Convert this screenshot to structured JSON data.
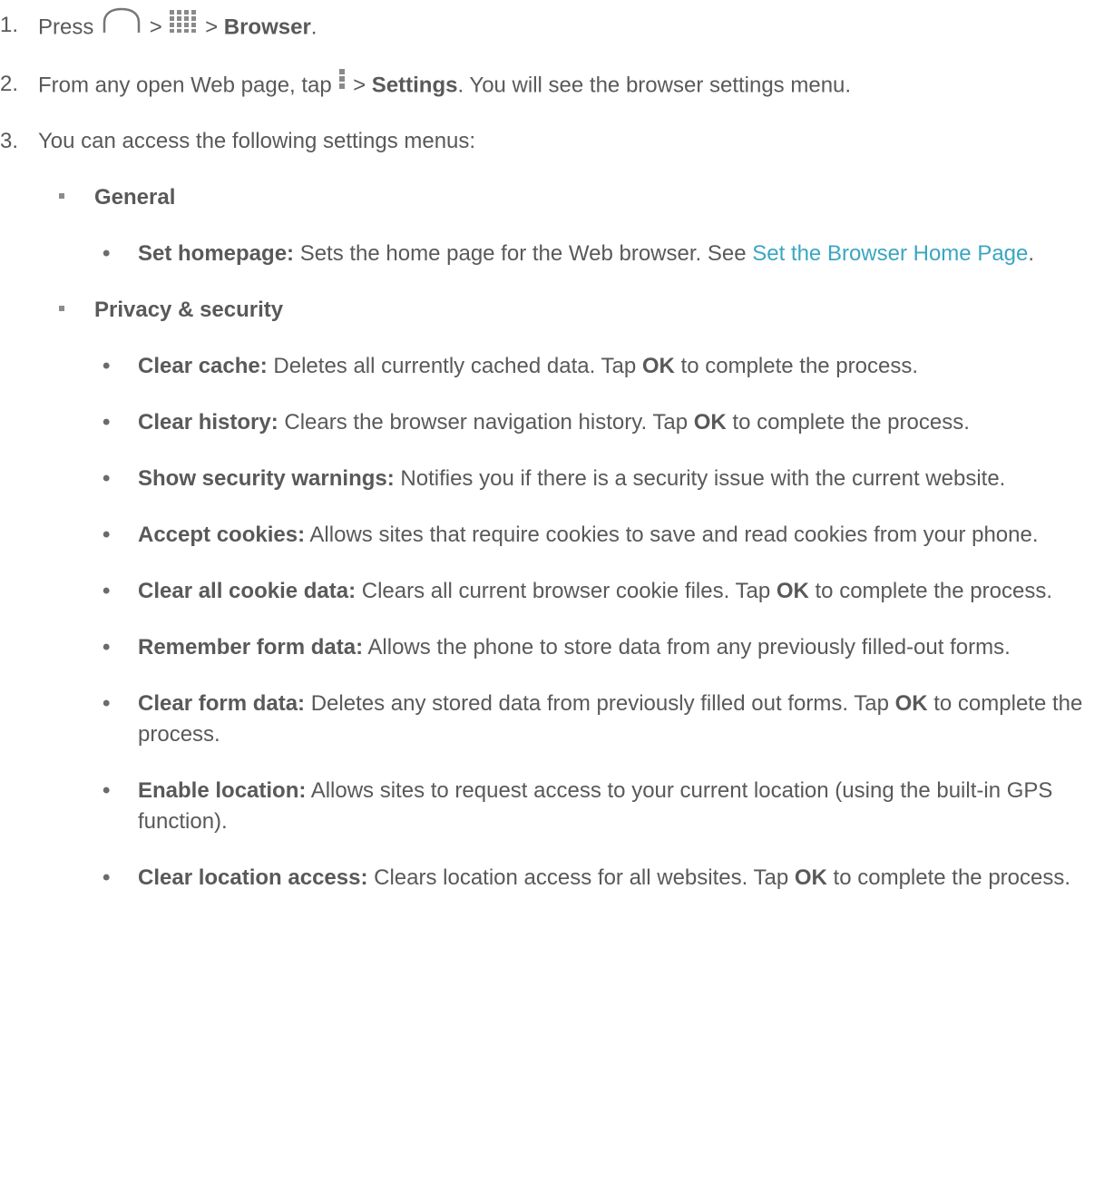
{
  "step1": {
    "num": "1.",
    "press": "Press",
    "sep1": ">",
    "sep2": ">",
    "target": "Browser",
    "end": ".",
    "icons": [
      "home-icon",
      "apps-grid-icon"
    ]
  },
  "step2": {
    "num": "2.",
    "pre": "From any open Web page, tap",
    "sep": ">",
    "target": "Settings",
    "post": ". You will see the browser settings menu.",
    "icon": "menu-dots-icon"
  },
  "step3": {
    "num": "3.",
    "text": "You can access the following settings menus:"
  },
  "sections": [
    {
      "title": "General",
      "items": [
        {
          "label": "Set homepage:",
          "text": " Sets the home page for the Web browser. See ",
          "link": "Set the Browser Home Page",
          "tail": "."
        }
      ]
    },
    {
      "title": "Privacy & security",
      "items": [
        {
          "label": "Clear cache:",
          "text": " Deletes all currently cached data. Tap ",
          "bold": "OK",
          "tail": " to complete the process."
        },
        {
          "label": "Clear history:",
          "text": " Clears the browser navigation history. Tap ",
          "bold": "OK",
          "tail": " to complete the process."
        },
        {
          "label": "Show security warnings:",
          "text": " Notifies you if there is a security issue with the current website."
        },
        {
          "label": "Accept cookies:",
          "text": " Allows sites that require cookies to save and read cookies from your phone."
        },
        {
          "label": "Clear all cookie data:",
          "text": " Clears all current browser cookie files. Tap ",
          "bold": "OK",
          "tail": " to complete the process."
        },
        {
          "label": "Remember form data:",
          "text": " Allows the phone to store data from any previously filled-out forms."
        },
        {
          "label": "Clear form data:",
          "text": " Deletes any stored data from previously filled out forms. Tap ",
          "bold": "OK",
          "tail": " to complete the process."
        },
        {
          "label": "Enable location:",
          "text": " Allows sites to request access to your current location (using the built-in GPS function)."
        },
        {
          "label": "Clear location access:",
          "text": " Clears location access for all websites. Tap ",
          "bold": "OK",
          "tail": " to complete the process."
        }
      ]
    }
  ]
}
